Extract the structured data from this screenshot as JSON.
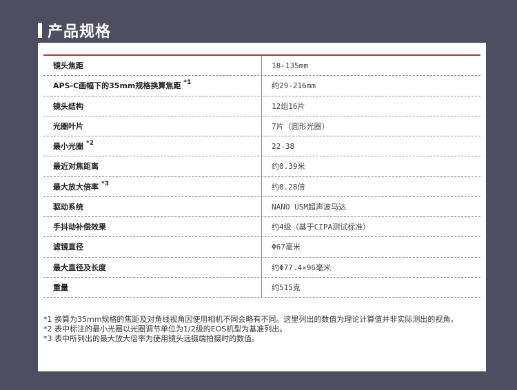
{
  "header": {
    "title": "产品规格"
  },
  "specs": [
    {
      "label": "镜头焦距",
      "note": "",
      "value": "18-135mm"
    },
    {
      "label": "APS-C画幅下的35mm规格换算焦距",
      "note": "*1",
      "value": "约29-216mm"
    },
    {
      "label": "镜头结构",
      "note": "",
      "value": "12组16片"
    },
    {
      "label": "光圈叶片",
      "note": "",
      "value": "7片（圆形光圈）"
    },
    {
      "label": "最小光圈",
      "note": "*2",
      "value": "22-38"
    },
    {
      "label": "最近对焦距离",
      "note": "",
      "value": "约0.39米"
    },
    {
      "label": "最大放大倍率",
      "note": "*3",
      "value": "约0.28倍"
    },
    {
      "label": "驱动系统",
      "note": "",
      "value": "NANO USM超声波马达"
    },
    {
      "label": "手抖动补偿效果",
      "note": "",
      "value": "约4级（基于CIPA测试标准）"
    },
    {
      "label": "滤镜直径",
      "note": "",
      "value": "Φ67毫米"
    },
    {
      "label": "最大直径及长度",
      "note": "",
      "value": "约Φ77.4×96毫米"
    },
    {
      "label": "重量",
      "note": "",
      "value": "约515克"
    }
  ],
  "footnotes": [
    "*1 换算为35mm规格的焦距及对角线视角因使用相机不同会略有不同。这里列出的数值为理论计算值并非实际测出的视角。",
    "*2 表中标注的最小光圈以光圈调节单位为1/2级的EOS机型为基准列出。",
    "*3 表中所列出的最大放大倍率为使用镜头远摄端拍摄时的数值。"
  ]
}
